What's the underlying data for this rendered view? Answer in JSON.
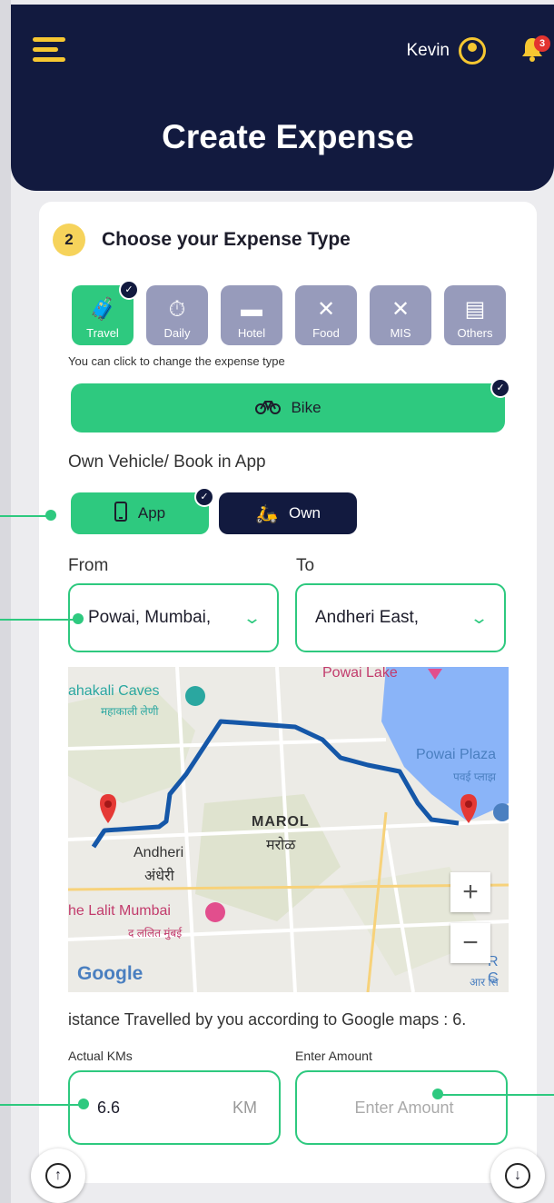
{
  "header": {
    "user_name": "Kevin",
    "notification_count": "3",
    "title": "Create Expense"
  },
  "step": {
    "number": "2",
    "title": "Choose your Expense Type"
  },
  "expense_types": [
    {
      "label": "Travel",
      "icon": "luggage-icon",
      "selected": true
    },
    {
      "label": "Daily",
      "icon": "daily-icon",
      "selected": false
    },
    {
      "label": "Hotel",
      "icon": "bed-icon",
      "selected": false
    },
    {
      "label": "Food",
      "icon": "cutlery-icon",
      "selected": false
    },
    {
      "label": "MIS",
      "icon": "cutlery-icon",
      "selected": false
    },
    {
      "label": "Others",
      "icon": "others-icon",
      "selected": false
    }
  ],
  "hint": "You can click to change the expense type",
  "vehicle": {
    "label": "Bike",
    "icon": "bicycle-icon"
  },
  "vehicle_mode_label": "Own Vehicle/ Book in App",
  "vehicle_modes": {
    "app": "App",
    "own": "Own"
  },
  "route": {
    "from_label": "From",
    "to_label": "To",
    "from_value": "Powai, Mumbai,",
    "to_value": "Andheri East,"
  },
  "map": {
    "labels": {
      "powai_lake": "Powai Lake",
      "mahakali": "ahakali Caves",
      "mahakali_hi": "महाकाली लेणी",
      "powai_plaza": "Powai Plaza",
      "powai_plaza_hi": "पवई प्लाझ",
      "marol": "MAROL",
      "marol_hi": "मरोळ",
      "andheri": "Andheri",
      "andheri_hi": "अंधेरी",
      "lalit": "he Lalit Mumbai",
      "lalit_hi": "द ललित मुंबई",
      "rc": "R C",
      "rc_hi": "आर सि"
    },
    "zoom_in": "+",
    "zoom_out": "−",
    "google": "Google"
  },
  "distance_text": "istance Travelled by you according to Google maps : 6.",
  "actual_km": {
    "label": "Actual KMs",
    "value": "6.6",
    "unit": "KM"
  },
  "amount": {
    "label": "Enter Amount",
    "placeholder": "Enter Amount"
  },
  "colors": {
    "navy": "#121a3f",
    "green": "#2ec97f",
    "yellow": "#f6c731",
    "grey_tile": "#979bbb"
  }
}
